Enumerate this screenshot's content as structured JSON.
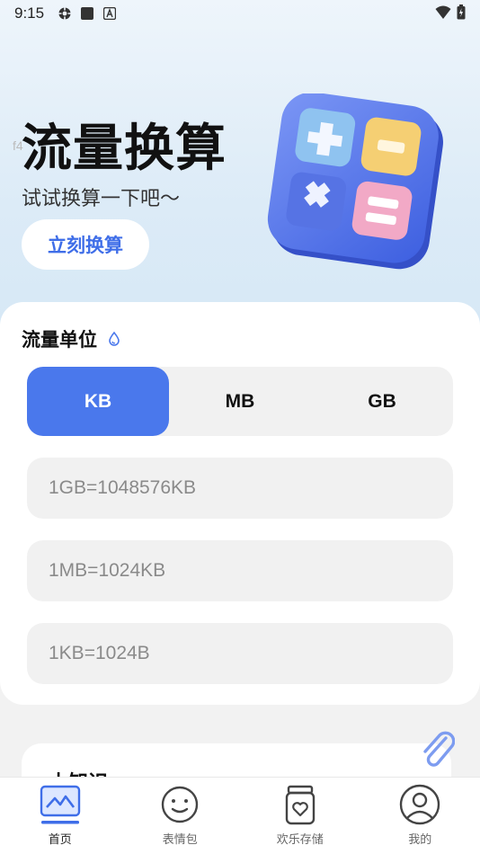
{
  "status_bar": {
    "time": "9:15",
    "left_icons": [
      "settings-gear-icon",
      "square-icon",
      "a-box-icon"
    ],
    "right_icons": [
      "wifi-icon",
      "battery-icon"
    ]
  },
  "hero": {
    "title": "流量换算",
    "subtitle": "试试换算一下吧～",
    "button_label": "立刻换算",
    "watermark": "f4"
  },
  "units_card": {
    "title": "流量单位",
    "unit_options": [
      "KB",
      "MB",
      "GB"
    ],
    "selected_unit": "KB",
    "conversions": [
      "1GB=1048576KB",
      "1MB=1024KB",
      "1KB=1024B"
    ]
  },
  "tips_card": {
    "title": "小知识"
  },
  "tabbar": {
    "tabs": [
      {
        "label": "首页",
        "icon": "chart-home-icon",
        "active": true
      },
      {
        "label": "表情包",
        "icon": "smiley-icon",
        "active": false
      },
      {
        "label": "欢乐存储",
        "icon": "jar-heart-icon",
        "active": false
      },
      {
        "label": "我的",
        "icon": "profile-icon",
        "active": false
      }
    ]
  },
  "colors": {
    "accent": "#4a78ec",
    "hero_bg": "#dcebf7",
    "button_text": "#3f6ee8"
  }
}
